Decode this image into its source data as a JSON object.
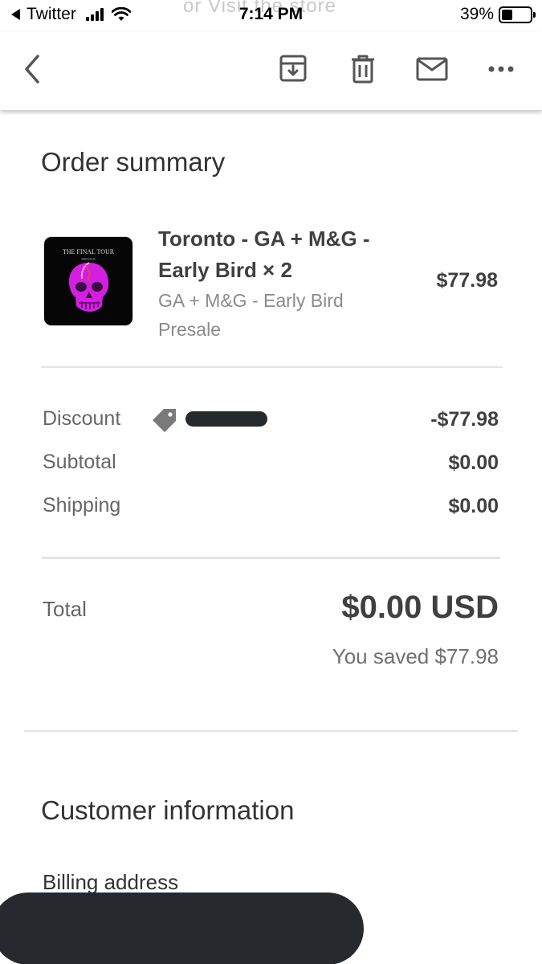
{
  "status_bar": {
    "back_app": "Twitter",
    "time": "7:14 PM",
    "battery_percent": "39%",
    "battery_level": 0.39,
    "behind_text": "or Visit the store"
  },
  "toolbar": {
    "icons": [
      "back-arrow-icon",
      "archive-icon",
      "trash-icon",
      "mail-icon",
      "more-icon"
    ]
  },
  "order_summary": {
    "title": "Order summary",
    "item": {
      "name": "Toronto - GA + M&G - Early Bird × 2",
      "variant": "GA + M&G - Early Bird Presale",
      "price": "$77.98",
      "thumbnail_title": "THE FINAL TOUR",
      "thumbnail_subtitle": "PRESALE"
    },
    "discount": {
      "label": "Discount",
      "value": "-$77.98"
    },
    "subtotal": {
      "label": "Subtotal",
      "value": "$0.00"
    },
    "shipping": {
      "label": "Shipping",
      "value": "$0.00"
    },
    "total": {
      "label": "Total",
      "value": "$0.00 USD"
    },
    "saved": "You saved $77.98"
  },
  "customer_information": {
    "title": "Customer information",
    "billing_label": "Billing address"
  },
  "colors": {
    "text_dark": "#404040",
    "text_muted": "#8a8a8a",
    "redaction": "#262a2e",
    "skull_magenta": "#d21fe0"
  }
}
